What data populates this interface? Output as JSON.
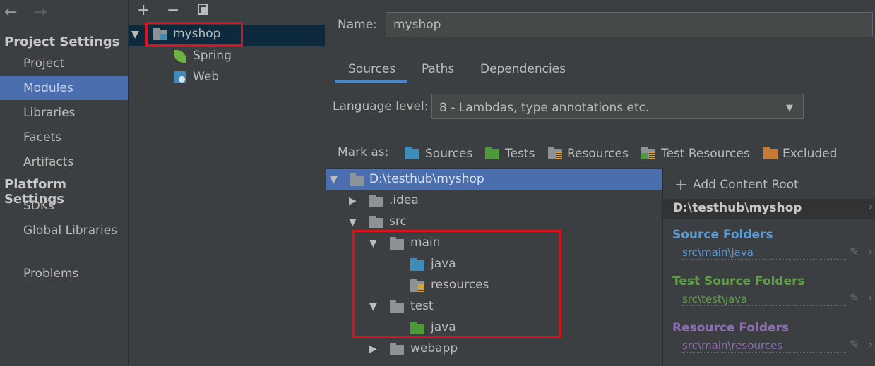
{
  "nav": {
    "back_icon": "back-arrow-icon",
    "forward_icon": "forward-arrow-icon",
    "project_settings": "Project Settings",
    "project_items": [
      "Project",
      "Modules",
      "Libraries",
      "Facets",
      "Artifacts"
    ],
    "platform_settings": "Platform Settings",
    "platform_items": [
      "SDKs",
      "Global Libraries"
    ],
    "problems": "Problems",
    "selected": "Modules"
  },
  "module_tree": {
    "toolbar": {
      "add": "+",
      "remove": "−"
    },
    "root": "myshop",
    "children": [
      "Spring",
      "Web"
    ]
  },
  "module": {
    "name_label": "Name:",
    "name_value": "myshop",
    "tabs": [
      "Sources",
      "Paths",
      "Dependencies"
    ],
    "active_tab": "Sources",
    "language_level_label": "Language level:",
    "language_level_value": "8 - Lambdas, type annotations etc.",
    "mark_as_label": "Mark as:",
    "mark_as": [
      {
        "label": "Sources",
        "color": "#3d8dbb"
      },
      {
        "label": "Tests",
        "color": "#4e9a3a"
      },
      {
        "label": "Resources",
        "color": "#8d9297"
      },
      {
        "label": "Test Resources",
        "color": "#8d9297"
      },
      {
        "label": "Excluded",
        "color": "#c77b32"
      }
    ]
  },
  "content_tree": {
    "root": "D:\\testhub\\myshop",
    "idea": ".idea",
    "src": "src",
    "main": "main",
    "main_java": "java",
    "main_resources": "resources",
    "test": "test",
    "test_java": "java",
    "webapp": "webapp"
  },
  "roots": {
    "add_content_root": "Add Content Root",
    "root_path": "D:\\testhub\\myshop",
    "source_folders_title": "Source Folders",
    "source_folder": "src\\main\\java",
    "test_folders_title": "Test Source Folders",
    "test_folder": "src\\test\\java",
    "resource_folders_title": "Resource Folders",
    "resource_folder": "src\\main\\resources",
    "colors": {
      "source": "#5a9bd6",
      "test": "#5fa046",
      "resource": "#8d6eb0"
    }
  }
}
